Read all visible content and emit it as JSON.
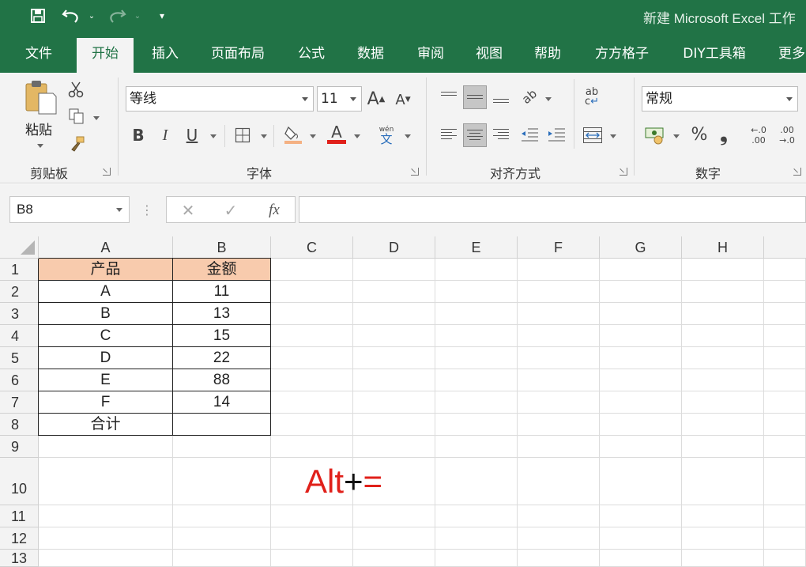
{
  "window": {
    "title": "新建 Microsoft Excel 工作"
  },
  "tabs": [
    "文件",
    "开始",
    "插入",
    "页面布局",
    "公式",
    "数据",
    "审阅",
    "视图",
    "帮助",
    "方方格子",
    "DIY工具箱",
    "更多"
  ],
  "active_tab": "开始",
  "ribbon": {
    "clipboard": {
      "label": "剪贴板",
      "paste": "粘贴"
    },
    "font": {
      "label": "字体",
      "name": "等线",
      "size": "11",
      "bold": "B",
      "italic": "I",
      "underline": "U",
      "grow": "A",
      "shrink": "A",
      "color_letter": "A",
      "phonetic_top": "wén",
      "phonetic_bottom": "文",
      "font_color": "#e0201a"
    },
    "alignment": {
      "label": "对齐方式",
      "wrap_top": "ab",
      "wrap_bottom": "c"
    },
    "number": {
      "label": "数字",
      "format": "常规",
      "percent": "%",
      "comma": "❟",
      "inc_top": "←.0",
      "inc_bottom": ".00",
      "dec_top": ".00",
      "dec_bottom": "→.0"
    }
  },
  "formula_bar": {
    "name_box": "B8",
    "cancel": "✕",
    "enter": "✓",
    "fx": "fx",
    "value": ""
  },
  "sheet": {
    "columns": [
      "A",
      "B",
      "C",
      "D",
      "E",
      "F",
      "G",
      "H"
    ],
    "rows": [
      "1",
      "2",
      "3",
      "4",
      "5",
      "6",
      "7",
      "8",
      "9",
      "10",
      "11",
      "12",
      "13"
    ],
    "header": [
      "产品",
      "金额"
    ],
    "data": [
      {
        "product": "A",
        "amount": "11"
      },
      {
        "product": "B",
        "amount": "13"
      },
      {
        "product": "C",
        "amount": "15"
      },
      {
        "product": "D",
        "amount": "22"
      },
      {
        "product": "E",
        "amount": "88"
      },
      {
        "product": "F",
        "amount": "14"
      }
    ],
    "total_label": "合计",
    "total_value": "",
    "header_fill": "#f8cbad"
  },
  "annotation": {
    "alt": "Alt",
    "plus": "+",
    "eq": "=",
    "accent": "#e0201a"
  }
}
